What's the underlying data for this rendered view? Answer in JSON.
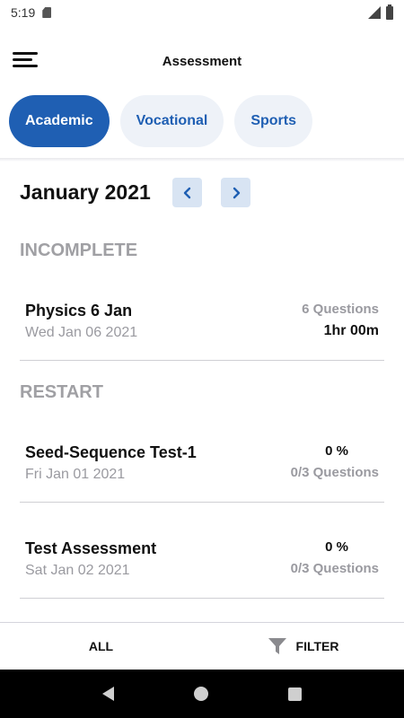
{
  "status_bar": {
    "time": "5:19"
  },
  "app_bar": {
    "title": "Assessment"
  },
  "tabs": [
    {
      "label": "Academic",
      "active": true
    },
    {
      "label": "Vocational",
      "active": false
    },
    {
      "label": "Sports",
      "active": false
    }
  ],
  "month": {
    "label": "January 2021"
  },
  "sections": {
    "incomplete": {
      "title": "INCOMPLETE",
      "items": [
        {
          "name": "Physics 6 Jan",
          "date": "Wed Jan 06 2021",
          "right_top": "6 Questions",
          "right_bottom": "1hr 00m"
        }
      ]
    },
    "restart": {
      "title": "RESTART",
      "items": [
        {
          "name": "Seed-Sequence Test-1",
          "date": "Fri Jan 01 2021",
          "right_top": "0 %",
          "right_bottom": "0/3 Questions"
        },
        {
          "name": "Test Assessment",
          "date": "Sat Jan 02 2021",
          "right_top": "0 %",
          "right_bottom": "0/3 Questions"
        }
      ]
    }
  },
  "bottom_bar": {
    "all_label": "ALL",
    "filter_label": "FILTER"
  },
  "colors": {
    "accent": "#1f5fb3",
    "tab_inactive_bg": "#eef2f8",
    "section_title": "#a0a0a4",
    "arrow_bg": "#d8e4f3"
  },
  "icons": {
    "menu": "hamburger-menu-icon",
    "prev": "chevron-left-icon",
    "next": "chevron-right-icon",
    "filter": "filter-funnel-icon"
  }
}
